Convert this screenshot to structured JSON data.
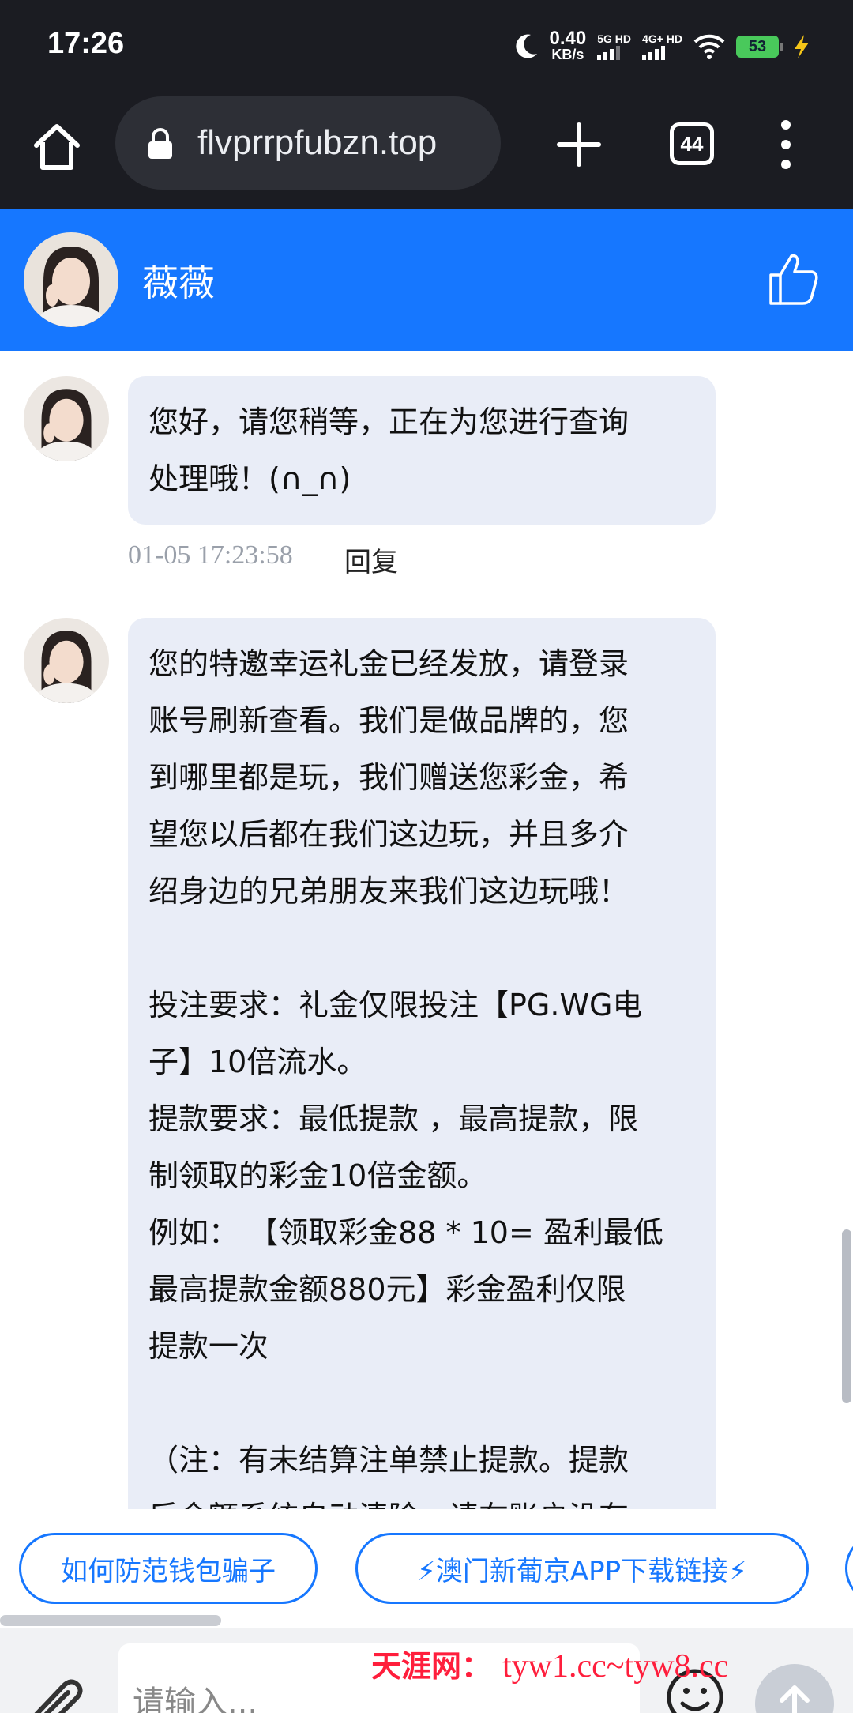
{
  "status_bar": {
    "time": "17:26",
    "speed_value": "0.40",
    "speed_unit": "KB/s",
    "net1": "5G HD",
    "net2": "4G+ HD",
    "battery": "53"
  },
  "browser": {
    "url": "flvprrpfubzn.top",
    "tab_count": "44"
  },
  "chat": {
    "agent_name": "薇薇",
    "messages": [
      {
        "text": "您好，请您稍等，正在为您进行查询\n处理哦！(∩_∩)",
        "time": "01-05 17:23:58",
        "reply": "回复"
      },
      {
        "text": "您的特邀幸运礼金已经发放，请登录\n账号刷新查看。我们是做品牌的，您\n到哪里都是玩，我们赠送您彩金，希\n望您以后都在我们这边玩，并且多介\n绍身边的兄弟朋友来我们这边玩哦！\n\n投注要求：礼金仅限投注【PG.WG电\n子】10倍流水。\n提款要求：最低提款 ，最高提款，限\n制领取的彩金10倍金额。\n例如： 【领取彩金88 * 10= 盈利最低\n最高提款金额880元】彩金盈利仅限\n提款一次\n\n（注：有未结算注单禁止提款。提款\n后余额系统自动清除，请在账户没有"
      }
    ]
  },
  "quick_replies": [
    "如何防范钱包骗子",
    "⚡澳门新葡京APP下载链接⚡"
  ],
  "input": {
    "placeholder": "请输入..."
  },
  "watermark": {
    "site_name": "天涯网：",
    "urls": "tyw1.cc~tyw8.cc"
  },
  "colors": {
    "header_blue": "#1677ff",
    "bubble_bg": "#e9edf7",
    "dark_bar": "#1b1c22",
    "watermark_red": "#ff1e3c"
  }
}
